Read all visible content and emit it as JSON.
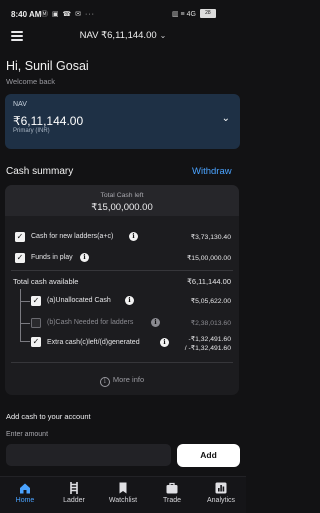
{
  "status_bar": {
    "time": "8:40 AM",
    "icons_left": "Ⓜ ▣ ☎ ✉ ···",
    "icons_right": "▥ ≡ 4G",
    "battery": "28"
  },
  "header": {
    "nav_title": "NAV ₹6,11,144.00"
  },
  "greeting": {
    "title": "Hi, Sunil Gosai",
    "subtitle": "Welcome back"
  },
  "nav_card": {
    "label": "NAV",
    "value": "₹6,11,144.00",
    "sub": "Primary (INR)"
  },
  "cash_summary": {
    "title": "Cash summary",
    "withdraw_label": "Withdraw",
    "total_label": "Total Cash left",
    "total_value": "₹15,00,000.00",
    "rows": [
      {
        "label": "Cash for new ladders(a+c)",
        "value": "₹3,73,130.40",
        "checked": true
      },
      {
        "label": "Funds in play",
        "value": "₹15,00,000.00",
        "checked": true
      }
    ],
    "total_available_label": "Total cash available",
    "total_available_value": "₹6,11,144.00",
    "sub_rows": [
      {
        "label": "(a)Unallocated Cash",
        "value": "₹5,05,622.00",
        "checked": true
      },
      {
        "label": "(b)Cash Needed for ladders",
        "value": "₹2,38,013.60",
        "checked": false
      },
      {
        "label": "Extra cash(c)left/(d)generated",
        "value_line1": "-₹1,32,491.60",
        "value_line2": "/ -₹1,32,491.60",
        "checked": true
      }
    ],
    "more_info": "More info"
  },
  "add_cash": {
    "title": "Add cash to your account",
    "input_label": "Enter amount",
    "input_value": "",
    "button_label": "Add"
  },
  "bottom_nav": {
    "tabs": [
      {
        "label": "Home",
        "icon": "home-icon",
        "active": true
      },
      {
        "label": "Ladder",
        "icon": "ladder-icon",
        "active": false
      },
      {
        "label": "Watchlist",
        "icon": "bookmark-icon",
        "active": false
      },
      {
        "label": "Trade",
        "icon": "briefcase-icon",
        "active": false
      },
      {
        "label": "Analytics",
        "icon": "bar-chart-icon",
        "active": false
      }
    ]
  },
  "colors": {
    "background": "#121214",
    "accent": "#4aa3ff",
    "nav_card": "#1e3045"
  }
}
